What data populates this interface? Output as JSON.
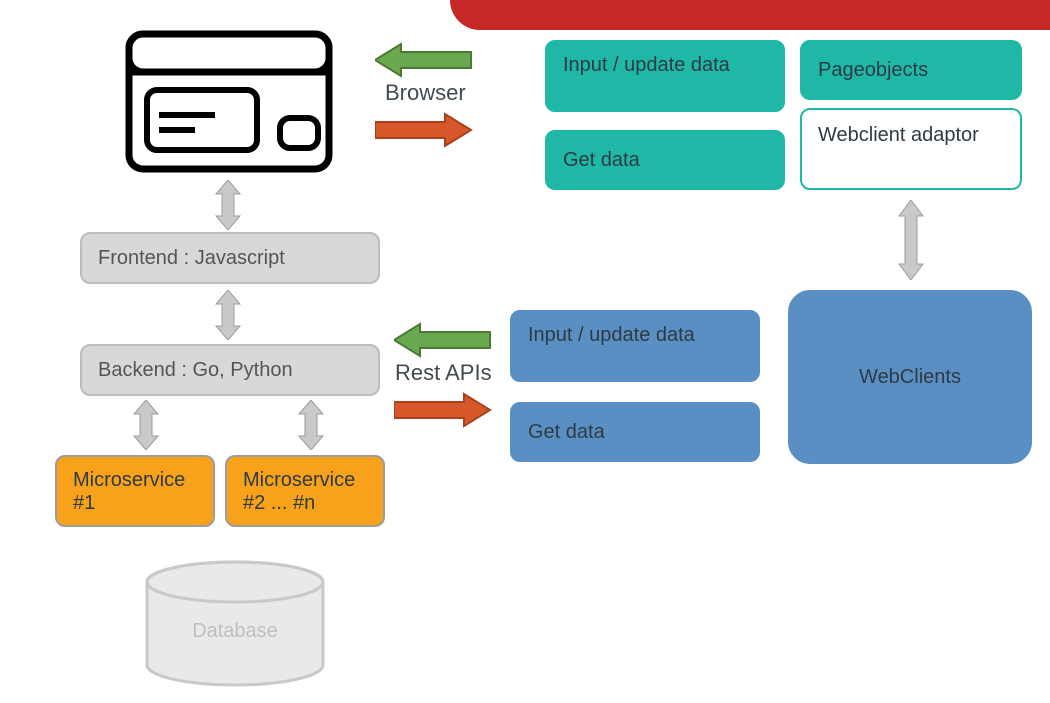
{
  "labels": {
    "browser": "Browser",
    "rest_apis": "Rest APIs"
  },
  "left_stack": {
    "frontend": "Frontend : Javascript",
    "backend": "Backend : Go, Python",
    "microservice1": "Microservice #1",
    "microservice2": "Microservice #2 ... #n",
    "database": "Database"
  },
  "top_right": {
    "input_update": "Input / update data",
    "get_data": "Get data",
    "pageobjects": "Pageobjects",
    "webclient_adaptor": "Webclient adaptor"
  },
  "bottom_right": {
    "input_update": "Input / update data",
    "get_data": "Get data",
    "webclients": "WebClients"
  },
  "colors": {
    "banner": "#c62828",
    "teal": "#1fb8a7",
    "blue": "#5a8fc4",
    "orange": "#f7a21a",
    "grey": "#d8d8d8",
    "arrow_green": "#6aa84f",
    "arrow_orange": "#d6582a",
    "arrow_grey": "#c9c9c9"
  }
}
